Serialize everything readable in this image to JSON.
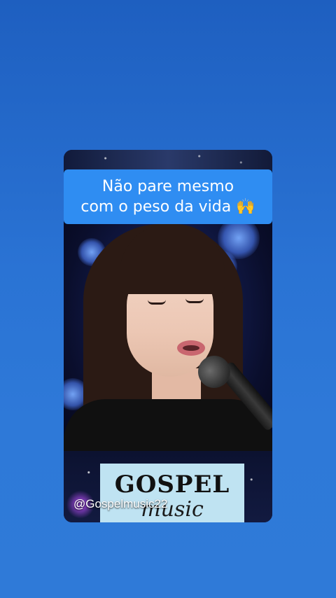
{
  "video": {
    "caption_line1": "Não pare mesmo",
    "caption_line2": "com o peso da vida 🙌",
    "logo": {
      "top_text": "GOSPEL",
      "bottom_text": "music"
    },
    "watermark_handle": "@Gospelmusic22"
  },
  "colors": {
    "background": "#2a73d4",
    "caption_bg": "#2f8df2",
    "logo_bg": "#bfe3f2"
  }
}
